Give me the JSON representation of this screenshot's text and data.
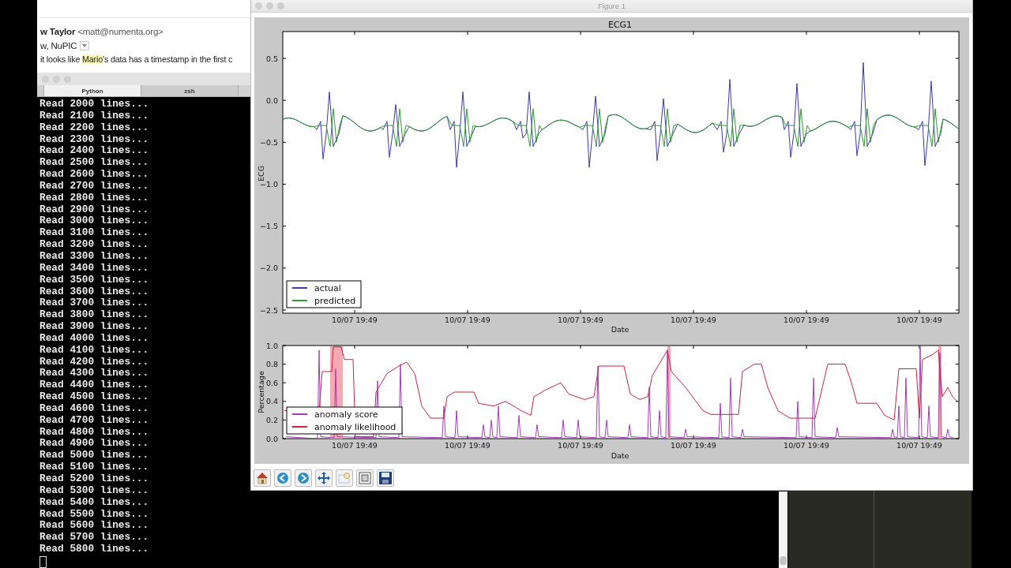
{
  "email": {
    "sender": "**w Taylor** <matt@numenta.org>",
    "recipients": "w, NuPIC",
    "body_lines": [
      {
        "segments": [
          {
            "text": "it looks like ",
            "highlighted": false
          },
          {
            "text": "Mario",
            "highlighted": true
          },
          {
            "text": "'s data has a timestamp in the first c",
            "highlighted": false
          }
        ]
      }
    ]
  },
  "terminal": {
    "tabs": [
      {
        "label": "Python",
        "selected": true
      },
      {
        "label": "zsh",
        "selected": false
      }
    ],
    "lines": [
      "Read 2000 lines...",
      "Read 2100 lines...",
      "Read 2200 lines...",
      "Read 2300 lines...",
      "Read 2400 lines...",
      "Read 2500 lines...",
      "Read 2600 lines...",
      "Read 2700 lines...",
      "Read 2800 lines...",
      "Read 2900 lines...",
      "Read 3000 lines...",
      "Read 3100 lines...",
      "Read 3200 lines...",
      "Read 3300 lines...",
      "Read 3400 lines...",
      "Read 3500 lines...",
      "Read 3600 lines...",
      "Read 3700 lines...",
      "Read 3800 lines...",
      "Read 3900 lines...",
      "Read 4000 lines...",
      "Read 4100 lines...",
      "Read 4200 lines...",
      "Read 4300 lines...",
      "Read 4400 lines...",
      "Read 4500 lines...",
      "Read 4600 lines...",
      "Read 4700 lines...",
      "Read 4800 lines...",
      "Read 4900 lines...",
      "Read 5000 lines...",
      "Read 5100 lines...",
      "Read 5200 lines...",
      "Read 5300 lines...",
      "Read 5400 lines...",
      "Read 5500 lines...",
      "Read 5600 lines...",
      "Read 5700 lines...",
      "Read 5800 lines..."
    ]
  },
  "figure": {
    "title": "Figure 1",
    "plots": [
      {
        "title": "ECG1",
        "ylabel": "ECG",
        "xlabel": "Date",
        "yticks": [
          "0.5",
          "0.0",
          "−0.5",
          "−1.0",
          "−1.5",
          "−2.0",
          "−2.5"
        ],
        "xticks": [
          "10/07 19:49",
          "10/07 19:49",
          "10/07 19:49",
          "10/07 19:49",
          "10/07 19:49",
          "10/07 19:49"
        ],
        "legend": [
          {
            "label": "actual",
            "color": "#3a3aa8"
          },
          {
            "label": "predicted",
            "color": "#2f9a2f"
          }
        ]
      },
      {
        "ylabel": "Percentage",
        "xlabel": "Date",
        "yticks": [
          "1.0",
          "0.8",
          "0.6",
          "0.4",
          "0.2",
          "0.0"
        ],
        "xticks": [
          "10/07 19:49",
          "10/07 19:49",
          "10/07 19:49",
          "10/07 19:49",
          "10/07 19:49",
          "10/07 19:49"
        ],
        "legend": [
          {
            "label": "anomaly score",
            "color": "#a33cb8"
          },
          {
            "label": "anomaly likelihood",
            "color": "#c8233f"
          }
        ]
      }
    ],
    "toolbar": [
      {
        "kind": "home"
      },
      {
        "kind": "back"
      },
      {
        "kind": "forward"
      },
      {
        "kind": "pan"
      },
      {
        "kind": "zoom"
      },
      {
        "kind": "configure"
      },
      {
        "kind": "save"
      }
    ]
  }
}
